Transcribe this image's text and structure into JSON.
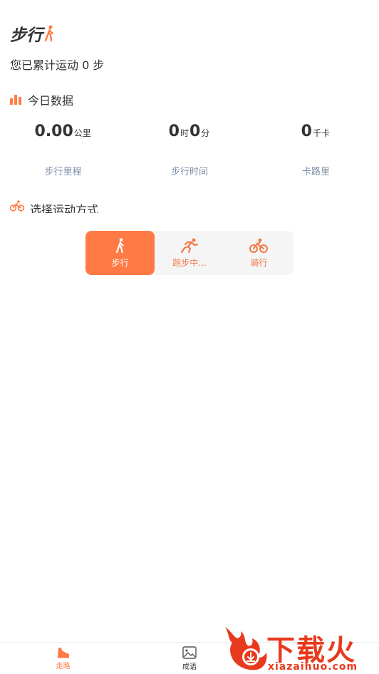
{
  "header": {
    "title": "步行",
    "title_icon": "walker-icon"
  },
  "summary": {
    "text": "您已累计运动 0 步"
  },
  "today": {
    "title": "今日数据",
    "stats": [
      {
        "value": "0.00",
        "unit": "公里",
        "label": "步行里程"
      },
      {
        "hours": "0",
        "hours_unit": "时",
        "minutes": "0",
        "minutes_unit": "分",
        "label": "步行时间"
      },
      {
        "value": "0",
        "unit": "千卡",
        "label": "卡路里"
      }
    ]
  },
  "mode": {
    "title": "选择运动方式",
    "tabs": [
      {
        "label": "步行",
        "icon": "walk-icon",
        "active": true
      },
      {
        "label": "跑步中...",
        "icon": "run-icon",
        "active": false
      },
      {
        "label": "骑行",
        "icon": "bike-icon",
        "active": false
      }
    ]
  },
  "nav": {
    "items": [
      {
        "label": "走路",
        "icon": "shoe-icon",
        "active": true
      },
      {
        "label": "成语",
        "icon": "image-icon",
        "active": false
      },
      {
        "label": "",
        "icon": "",
        "active": false
      }
    ]
  },
  "watermark": {
    "text": "下载火",
    "url": "xiazaihuo.com"
  },
  "colors": {
    "accent": "#ff7a45",
    "muted_label": "#7c8ea6",
    "tab_bg": "#f5f5f5",
    "watermark": "#e83a1e"
  }
}
